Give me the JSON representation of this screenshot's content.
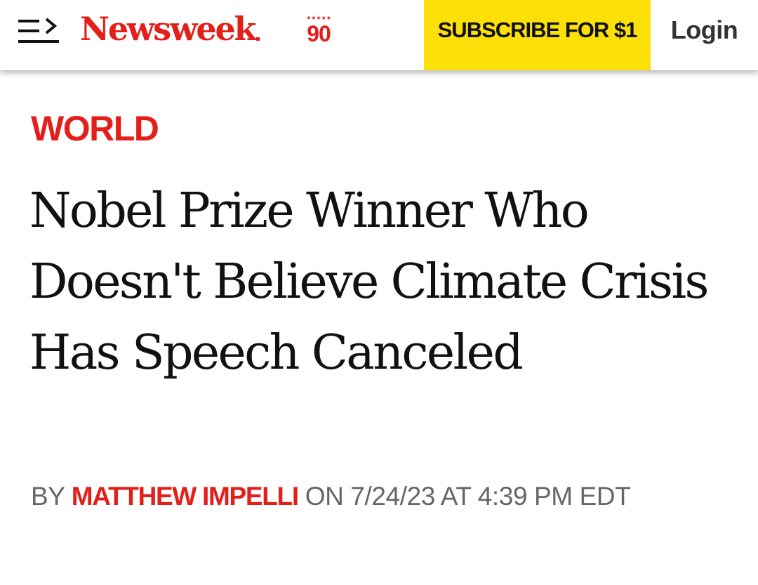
{
  "header": {
    "menu_icon": "hamburger-menu-arrow-icon",
    "logo_text": "Newsweek",
    "anniversary_stars": "★★★★★",
    "anniversary_number": "90",
    "subscribe_label": "SUBSCRIBE FOR $1",
    "login_label": "Login"
  },
  "article": {
    "category": "WORLD",
    "headline": "Nobel Prize Winner Who Doesn't Believe Climate Crisis Has Speech Canceled",
    "byline_prefix": "BY",
    "author": "MATTHEW IMPELLI",
    "byline_date": "ON 7/24/23 AT 4:39 PM EDT"
  },
  "colors": {
    "brand_red": "#e41f1a",
    "subscribe_yellow": "#fde007",
    "headline_text": "#111111",
    "byline_gray": "#666666"
  }
}
